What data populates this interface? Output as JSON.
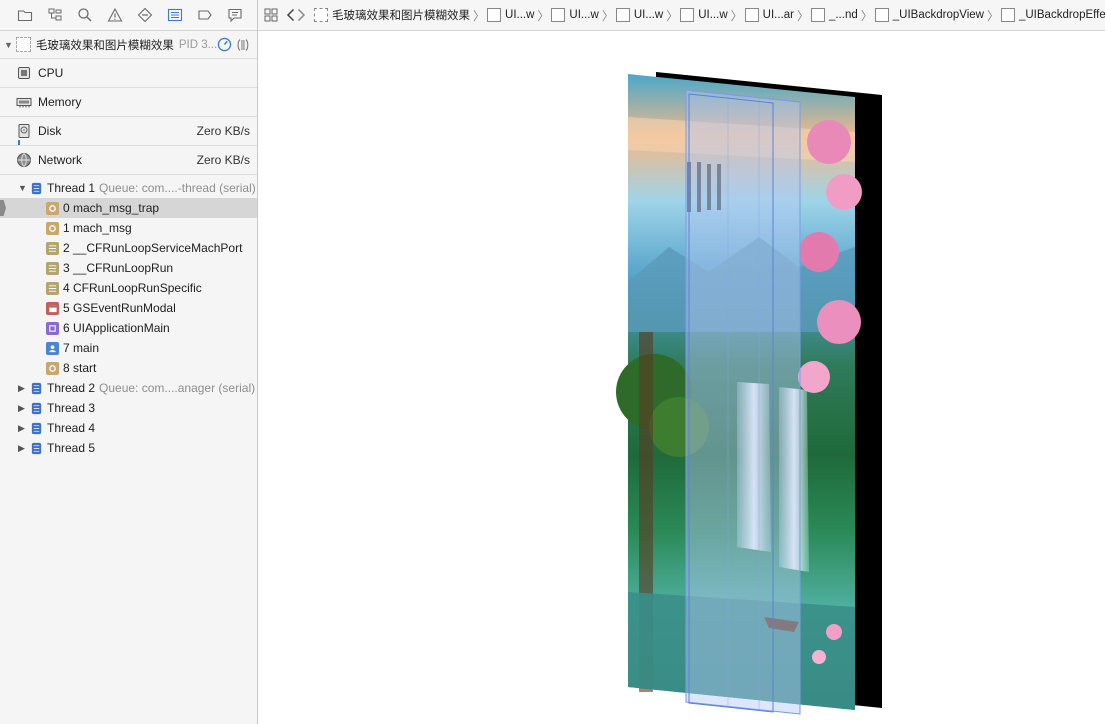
{
  "navigator": {
    "process": {
      "name": "毛玻璃效果和图片模糊效果",
      "pid": "PID 3..."
    },
    "gauges": [
      {
        "label": "CPU",
        "value": ""
      },
      {
        "label": "Memory",
        "value": ""
      },
      {
        "label": "Disk",
        "value": "Zero KB/s"
      },
      {
        "label": "Network",
        "value": "Zero KB/s"
      }
    ],
    "thread1": {
      "label": "Thread 1",
      "queue": "Queue: com....-thread (serial)",
      "frames": [
        {
          "label": "0 mach_msg_trap",
          "kind": "gear",
          "color": "#c9a86b"
        },
        {
          "label": "1 mach_msg",
          "kind": "gear",
          "color": "#c9a86b"
        },
        {
          "label": "2 __CFRunLoopServiceMachPort",
          "kind": "lines",
          "color": "#b5a46b"
        },
        {
          "label": "3 __CFRunLoopRun",
          "kind": "lines",
          "color": "#b5a46b"
        },
        {
          "label": "4 CFRunLoopRunSpecific",
          "kind": "lines",
          "color": "#b5a46b"
        },
        {
          "label": "5 GSEventRunModal",
          "kind": "window",
          "color": "#c0605a"
        },
        {
          "label": "6 UIApplicationMain",
          "kind": "app",
          "color": "#8b6bc9"
        },
        {
          "label": "7 main",
          "kind": "user",
          "color": "#4a86d0"
        },
        {
          "label": "8 start",
          "kind": "gear",
          "color": "#c9a86b"
        }
      ]
    },
    "threads": [
      {
        "label": "Thread 2",
        "queue": "Queue: com....anager (serial)"
      },
      {
        "label": "Thread 3",
        "queue": ""
      },
      {
        "label": "Thread 4",
        "queue": ""
      },
      {
        "label": "Thread 5",
        "queue": ""
      }
    ]
  },
  "jumpbar": {
    "crumbs": [
      {
        "label": "毛玻璃效果和图片模糊效果"
      },
      {
        "label": "UI...w"
      },
      {
        "label": "UI...w"
      },
      {
        "label": "UI...w"
      },
      {
        "label": "UI...w"
      },
      {
        "label": "UI...ar"
      },
      {
        "label": "_...nd"
      },
      {
        "label": "_UIBackdropView"
      },
      {
        "label": "_UIBackdropEffect"
      }
    ]
  },
  "colors": {
    "selection": "#d6d6d6",
    "accent": "#3a7bd5",
    "thread_icon": "#3f6fc7"
  }
}
